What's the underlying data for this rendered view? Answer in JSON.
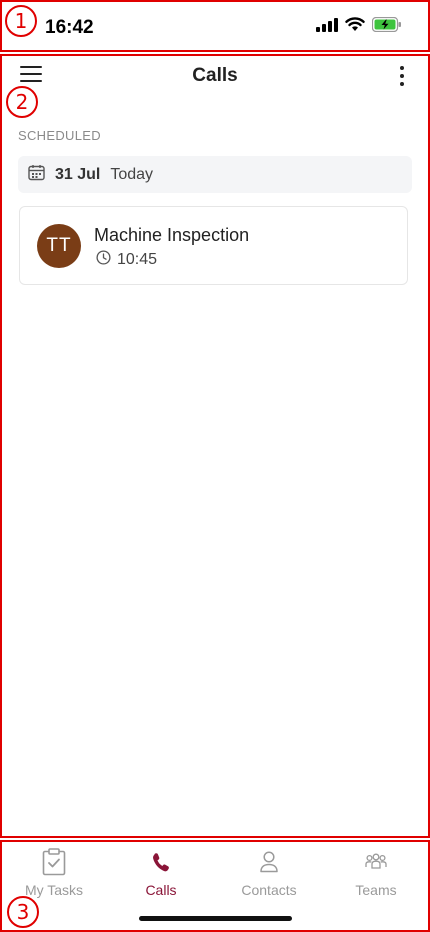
{
  "status_bar": {
    "time": "16:42"
  },
  "markers": [
    "1",
    "2",
    "3"
  ],
  "header": {
    "title": "Calls"
  },
  "scheduled": {
    "section_label": "SCHEDULED",
    "date": {
      "day": "31 Jul",
      "relative": "Today"
    },
    "calls": [
      {
        "avatar_initials": "TT",
        "avatar_color": "#7a3d16",
        "title": "Machine Inspection",
        "time": "10:45"
      }
    ]
  },
  "tabs": [
    {
      "label": "My Tasks",
      "icon": "clipboard-check-icon",
      "active": false
    },
    {
      "label": "Calls",
      "icon": "phone-icon",
      "active": true
    },
    {
      "label": "Contacts",
      "icon": "person-icon",
      "active": false
    },
    {
      "label": "Teams",
      "icon": "group-icon",
      "active": false
    }
  ],
  "colors": {
    "accent": "#8a1538",
    "annotation": "#e00000",
    "battery": "#3ec43e"
  }
}
